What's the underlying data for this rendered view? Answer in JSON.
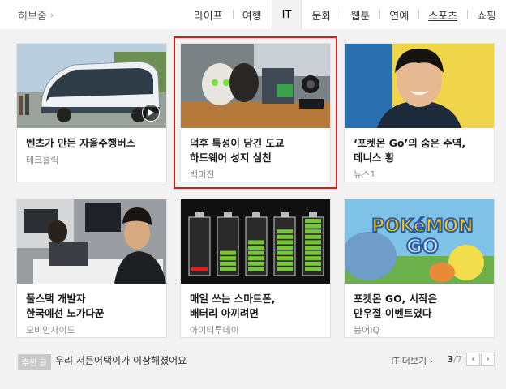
{
  "header": {
    "hub_label": "허브줌",
    "tabs": [
      "라이프",
      "여행",
      "IT",
      "문화",
      "웹툰",
      "연예",
      "스포츠",
      "쇼핑"
    ],
    "active_tab": "IT"
  },
  "cards": [
    {
      "title": "벤츠가 만든 자율주행버스",
      "source": "테크홀릭"
    },
    {
      "title": "덕후 특성이 담긴 도교\n하드웨어 성지 심천",
      "source": "백미진"
    },
    {
      "title": "‘포켓몬 Go’의 숨은 주역,\n데니스 황",
      "source": "뉴스1"
    },
    {
      "title": "풀스택 개발자\n한국에선 노가다꾼",
      "source": "모비인사이드"
    },
    {
      "title": "매일 쓰는 스마트폰,\n배터리 아끼려면",
      "source": "아이티투데이"
    },
    {
      "title": "포켓몬 GO, 시작은\n만우절 이벤트였다",
      "source": "붕어IQ"
    }
  ],
  "images": {
    "pokemon_logo_line1": "POKéMON",
    "pokemon_logo_line2": "GO"
  },
  "footer": {
    "badge": "추천 글",
    "text": "우리 서든어택이가 이상해졌어요",
    "more_label": "IT 더보기 ›",
    "page_current": "3",
    "page_total": "/7",
    "prev_label": "‹",
    "next_label": "›"
  },
  "colors": {
    "accent_selected": "#d7191c",
    "battery_green": "#77c63a",
    "battery_red": "#e02020"
  }
}
